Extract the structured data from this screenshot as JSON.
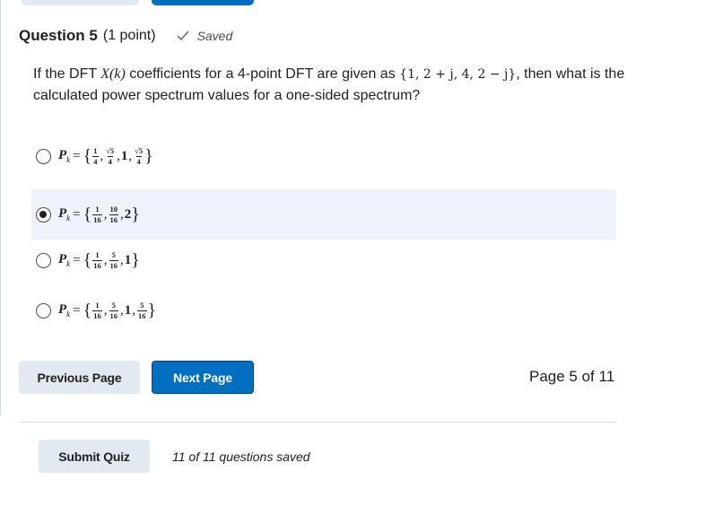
{
  "question": {
    "title": "Question 5",
    "points": "(1 point)",
    "saved_label": "Saved",
    "text_before": "If the DFT ",
    "text_xk": "X(k)",
    "text_middle": " coefficients for a 4-point DFT are given as ",
    "text_set": "{1, 2 + j, 4, 2 − j}",
    "text_after": ", then what is the calculated power spectrum values for a one-sided spectrum?"
  },
  "options": [
    {
      "pk": "P",
      "sub": "k",
      "eq": "=",
      "open": "{",
      "close": "}",
      "t1n": "1",
      "t1d": "4",
      "t2n": "√5",
      "t2d": "4",
      "t3": "1",
      "t4n": "√5",
      "t4d": "4",
      "selected": false
    },
    {
      "pk": "P",
      "sub": "k",
      "eq": "=",
      "open": "{",
      "close": "}",
      "t1n": "1",
      "t1d": "16",
      "t2n": "10",
      "t2d": "16",
      "t3": "2",
      "selected": true
    },
    {
      "pk": "P",
      "sub": "k",
      "eq": "=",
      "open": "{",
      "close": "}",
      "t1n": "1",
      "t1d": "16",
      "t2n": "5",
      "t2d": "16",
      "t3": "1",
      "selected": false
    },
    {
      "pk": "P",
      "sub": "k",
      "eq": "=",
      "open": "{",
      "close": "}",
      "t1n": "1",
      "t1d": "16",
      "t2n": "5",
      "t2d": "16",
      "t3": "1",
      "t4n": "5",
      "t4d": "16",
      "selected": false
    }
  ],
  "nav": {
    "previous_label": "Previous Page",
    "next_label": "Next Page",
    "page_indicator": "Page 5 of 11"
  },
  "footer": {
    "submit_label": "Submit Quiz",
    "saved_status": "11 of 11 questions saved"
  },
  "colors": {
    "primary": "#006fbf",
    "secondary_button": "#e3e9f1",
    "selected_option_bg": "#edf2fb",
    "saved_check": "#6e7477"
  },
  "icons": {
    "saved": "checkmark-icon"
  }
}
